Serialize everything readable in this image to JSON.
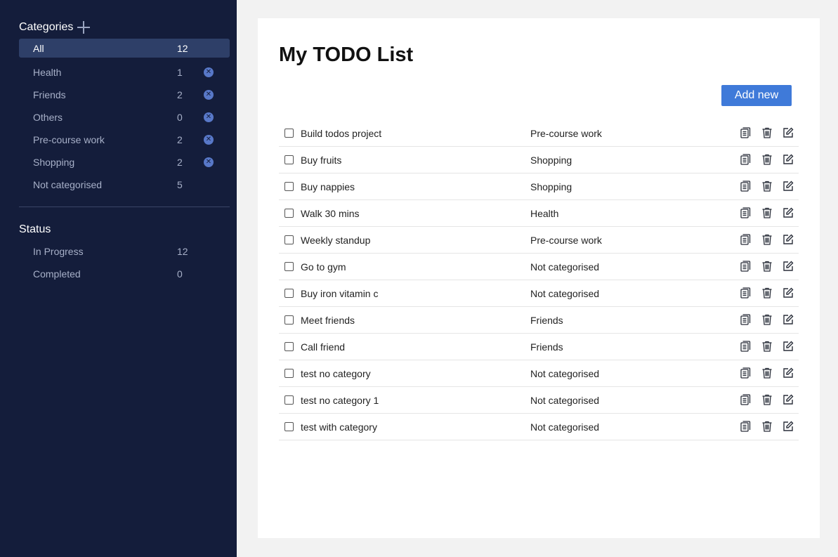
{
  "sidebar": {
    "categories_title": "Categories",
    "categories": [
      {
        "label": "All",
        "count": "12",
        "active": true,
        "deletable": false
      },
      {
        "label": "Health",
        "count": "1",
        "active": false,
        "deletable": true
      },
      {
        "label": "Friends",
        "count": "2",
        "active": false,
        "deletable": true
      },
      {
        "label": "Others",
        "count": "0",
        "active": false,
        "deletable": true
      },
      {
        "label": "Pre-course work",
        "count": "2",
        "active": false,
        "deletable": true
      },
      {
        "label": "Shopping",
        "count": "2",
        "active": false,
        "deletable": true
      },
      {
        "label": "Not categorised",
        "count": "5",
        "active": false,
        "deletable": false
      }
    ],
    "status_title": "Status",
    "statuses": [
      {
        "label": "In Progress",
        "count": "12"
      },
      {
        "label": "Completed",
        "count": "0"
      }
    ]
  },
  "main": {
    "title": "My TODO List",
    "add_button_label": "Add new",
    "todos": [
      {
        "title": "Build todos project",
        "category": "Pre-course work"
      },
      {
        "title": "Buy fruits",
        "category": "Shopping"
      },
      {
        "title": "Buy nappies",
        "category": "Shopping"
      },
      {
        "title": "Walk 30 mins",
        "category": "Health"
      },
      {
        "title": "Weekly standup",
        "category": "Pre-course work"
      },
      {
        "title": "Go to gym",
        "category": "Not categorised"
      },
      {
        "title": "Buy iron vitamin c",
        "category": "Not categorised"
      },
      {
        "title": "Meet friends",
        "category": "Friends"
      },
      {
        "title": "Call friend",
        "category": "Friends"
      },
      {
        "title": "test no category",
        "category": "Not categorised"
      },
      {
        "title": "test no category 1",
        "category": "Not categorised"
      },
      {
        "title": "test with category",
        "category": "Not categorised"
      }
    ]
  },
  "colors": {
    "sidebar_bg": "#141d3b",
    "sidebar_active_bg": "#2e3f68",
    "accent": "#3f7ad9",
    "delete_badge": "#5878c8"
  },
  "icons": {
    "row_actions": [
      "copy-icon",
      "trash-icon",
      "edit-icon"
    ],
    "category_delete": "close-circle-icon",
    "add_category": "plus-icon"
  }
}
